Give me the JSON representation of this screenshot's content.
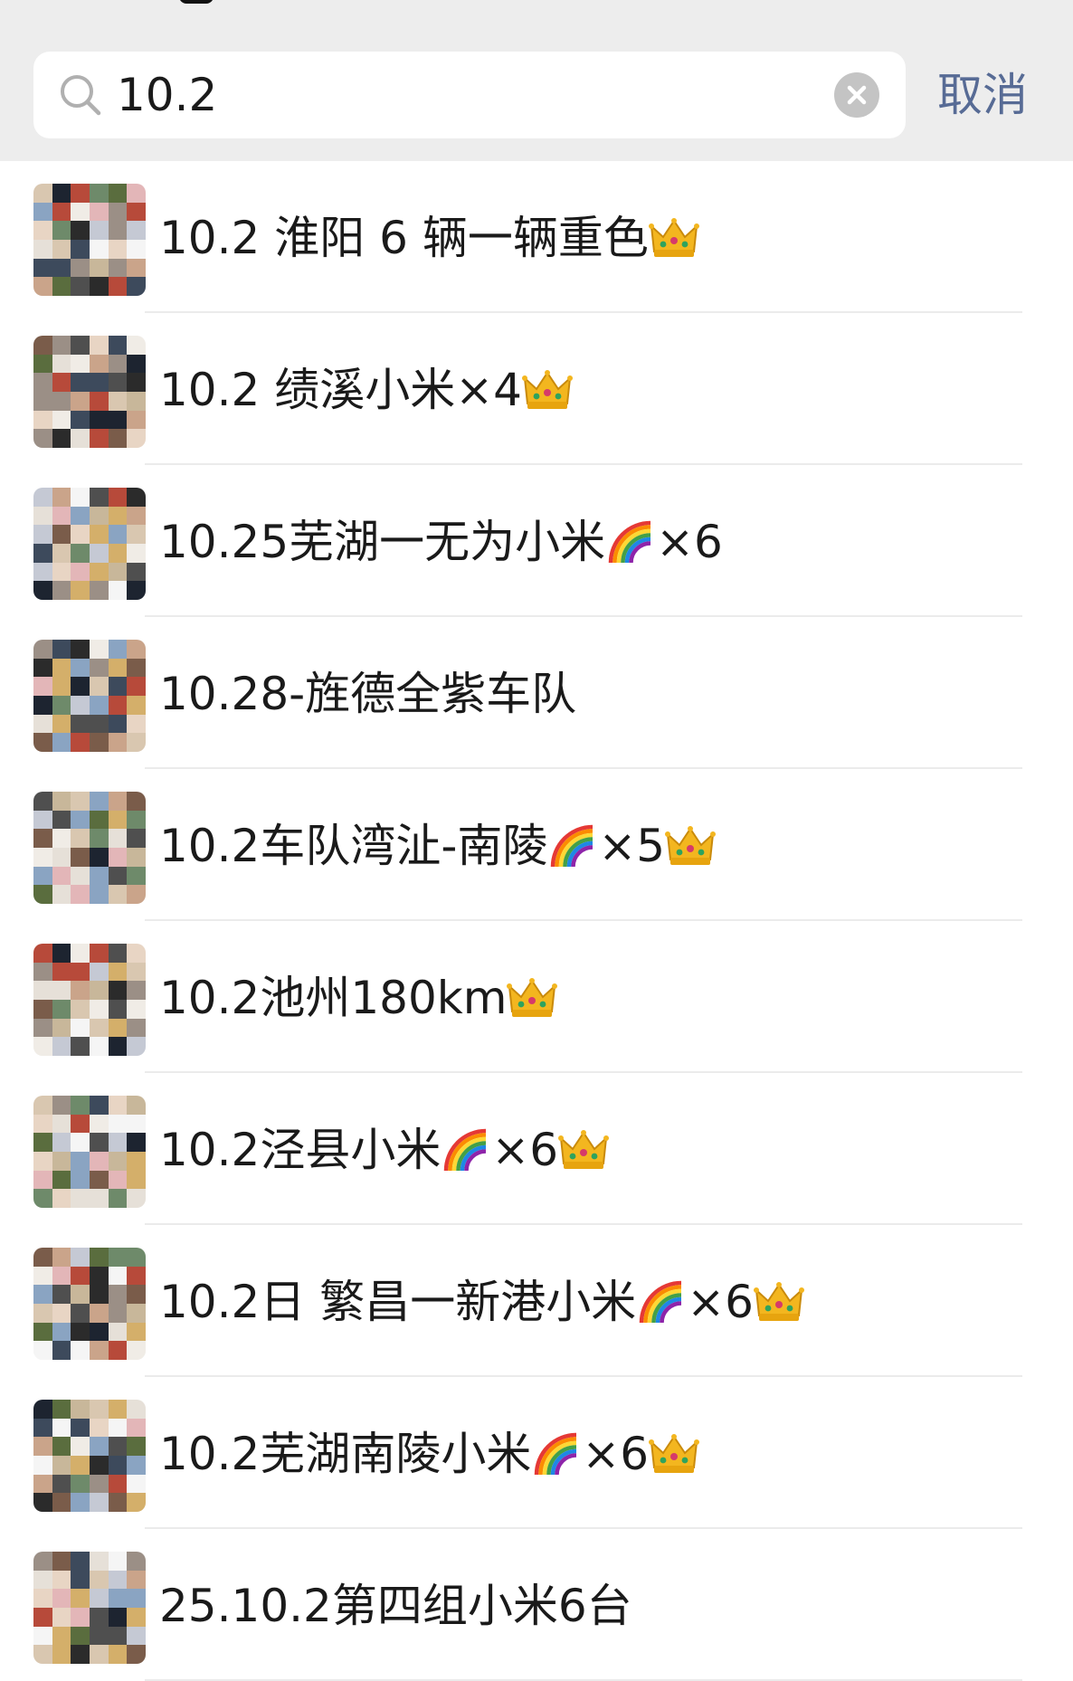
{
  "search": {
    "value": "10.2",
    "placeholder": "",
    "cancel_label": "取消"
  },
  "results": [
    {
      "parts": [
        {
          "t": "text",
          "v": "10.2 淮阳 6 辆一辆重色"
        },
        {
          "t": "emoji",
          "v": "crown"
        }
      ]
    },
    {
      "parts": [
        {
          "t": "text",
          "v": "10.2 绩溪小米×4"
        },
        {
          "t": "emoji",
          "v": "crown"
        }
      ]
    },
    {
      "parts": [
        {
          "t": "text",
          "v": "10.25芜湖一无为小米"
        },
        {
          "t": "emoji",
          "v": "rainbow"
        },
        {
          "t": "text",
          "v": "×6"
        }
      ]
    },
    {
      "parts": [
        {
          "t": "text",
          "v": "10.28-旌德全紫车队"
        }
      ]
    },
    {
      "parts": [
        {
          "t": "text",
          "v": "10.2车队湾沚-南陵"
        },
        {
          "t": "emoji",
          "v": "rainbow"
        },
        {
          "t": "text",
          "v": "×5"
        },
        {
          "t": "emoji",
          "v": "crown"
        }
      ]
    },
    {
      "parts": [
        {
          "t": "text",
          "v": "10.2池州180km"
        },
        {
          "t": "emoji",
          "v": "crown"
        }
      ]
    },
    {
      "parts": [
        {
          "t": "text",
          "v": "10.2泾县小米"
        },
        {
          "t": "emoji",
          "v": "rainbow"
        },
        {
          "t": "text",
          "v": "×6"
        },
        {
          "t": "emoji",
          "v": "crown"
        }
      ]
    },
    {
      "parts": [
        {
          "t": "text",
          "v": "10.2日 繁昌一新港小米"
        },
        {
          "t": "emoji",
          "v": "rainbow"
        },
        {
          "t": "text",
          "v": "×6"
        },
        {
          "t": "emoji",
          "v": "crown"
        }
      ]
    },
    {
      "parts": [
        {
          "t": "text",
          "v": "10.2芜湖南陵小米"
        },
        {
          "t": "emoji",
          "v": "rainbow"
        },
        {
          "t": "text",
          "v": "×6"
        },
        {
          "t": "emoji",
          "v": "crown"
        }
      ]
    },
    {
      "parts": [
        {
          "t": "text",
          "v": "25.10.2第四组小米6台"
        }
      ]
    }
  ],
  "colors": {
    "header_bg": "#ededed",
    "cancel": "#576b95",
    "text": "#1a1a1a",
    "divider": "#ebebeb",
    "clear_icon": "#c4c4c4"
  }
}
